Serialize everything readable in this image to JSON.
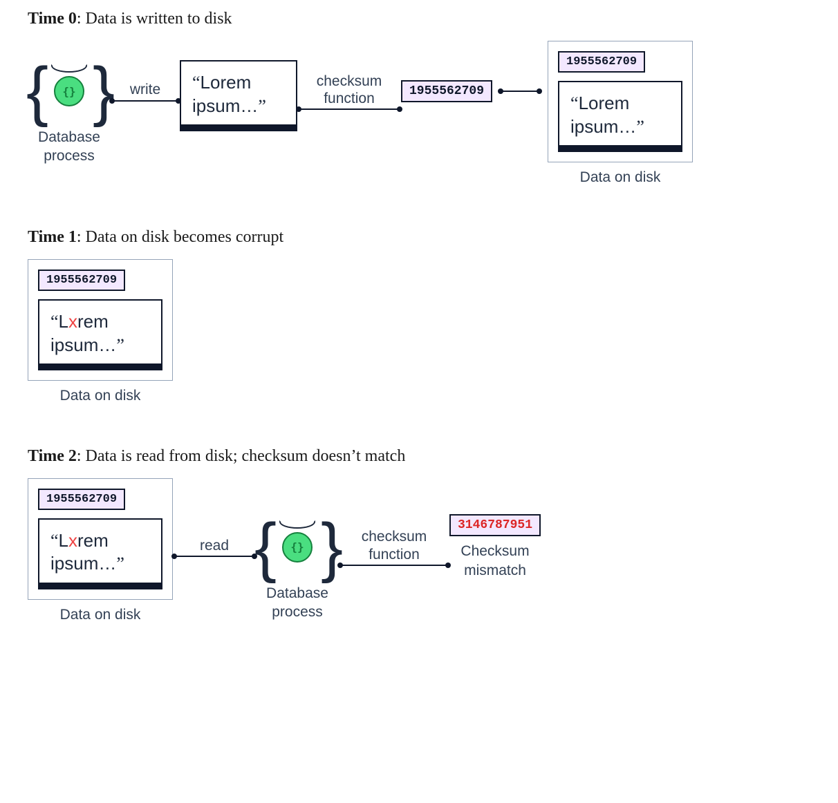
{
  "time0": {
    "title_bold": "Time 0",
    "title_rest": ": Data is written to disk",
    "db_label": "Database\nprocess",
    "arrow_write": "write",
    "doc_line1": "Lorem",
    "doc_line2": "ipsum…",
    "arrow_checksum": "checksum\nfunction",
    "checksum_value": "1955562709",
    "disk_checksum": "1955562709",
    "disk_doc_line1": "Lorem",
    "disk_doc_line2": "ipsum…",
    "disk_label": "Data on disk"
  },
  "time1": {
    "title_bold": "Time 1",
    "title_rest": ": Data on disk becomes corrupt",
    "disk_checksum": "1955562709",
    "doc_pre": "L",
    "doc_bad": "x",
    "doc_post": "rem",
    "doc_line2": "ipsum…",
    "disk_label": "Data on disk"
  },
  "time2": {
    "title_bold": "Time 2",
    "title_rest": ": Data is read from disk; checksum doesn’t match",
    "disk_checksum": "1955562709",
    "doc_pre": "L",
    "doc_bad": "x",
    "doc_post": "rem",
    "doc_line2": "ipsum…",
    "disk_label": "Data on disk",
    "arrow_read": "read",
    "db_label": "Database\nprocess",
    "arrow_checksum": "checksum\nfunction",
    "checksum_value": "3146787951",
    "mismatch_label": "Checksum\nmismatch"
  }
}
